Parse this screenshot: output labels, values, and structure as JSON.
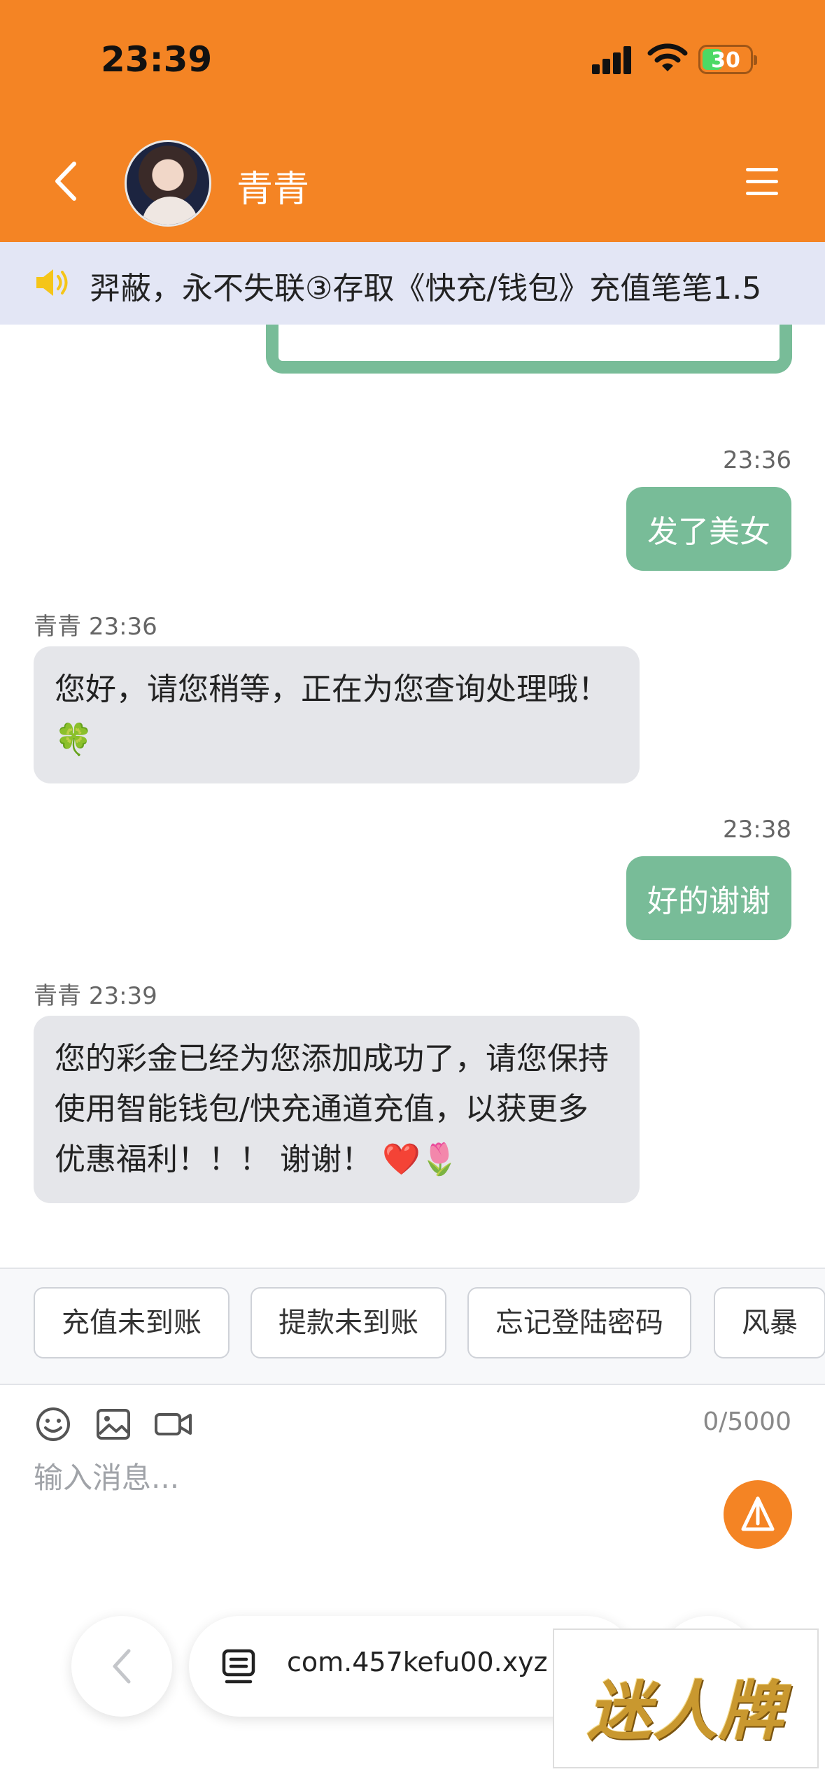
{
  "status_bar": {
    "time": "23:39",
    "battery": "30"
  },
  "header": {
    "title": "青青"
  },
  "notice": {
    "text": "羿蔽，永不失联③存取《快充/钱包》充值笔笔1.5"
  },
  "messages": [
    {
      "side": "right",
      "time": "23:36",
      "text": "发了美女"
    },
    {
      "side": "left",
      "sender": "青青",
      "time": "23:36",
      "text": "您好，请您稍等，正在为您查询处理哦！🍀"
    },
    {
      "side": "right",
      "time": "23:38",
      "text": "好的谢谢"
    },
    {
      "side": "left",
      "sender": "青青",
      "time": "23:39",
      "text": "您的彩金已经为您添加成功了，请您保持使用智能钱包/快充通道充值，以获更多优惠福利！！！ 谢谢！ ❤️🌷"
    }
  ],
  "quick_replies": [
    "充值未到账",
    "提款未到账",
    "忘记登陆密码",
    "风暴"
  ],
  "composer": {
    "counter": "0/5000",
    "placeholder": "输入消息..."
  },
  "browser": {
    "url": "com.457kefu00.xyz"
  },
  "watermark": {
    "text": "迷人牌"
  },
  "colors": {
    "accent": "#f48424",
    "bubble_outgoing": "#78bc98",
    "bubble_incoming": "#e5e6ea",
    "notice_bg": "#e3e6f5"
  }
}
